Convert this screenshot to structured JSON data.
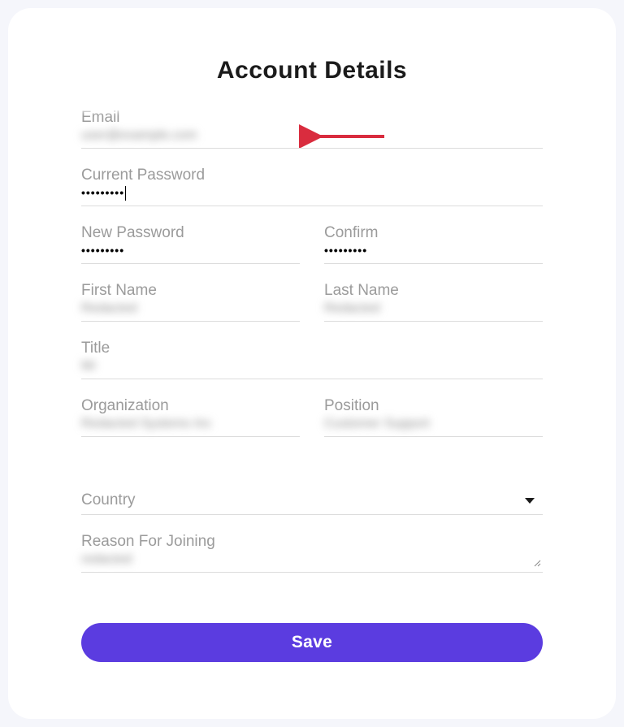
{
  "title": "Account Details",
  "fields": {
    "email": {
      "label": "Email",
      "value": "user@example.com"
    },
    "currentPassword": {
      "label": "Current Password",
      "value": "•••••••••"
    },
    "newPassword": {
      "label": "New Password",
      "value": "•••••••••"
    },
    "confirm": {
      "label": "Confirm",
      "value": "•••••••••"
    },
    "firstName": {
      "label": "First Name",
      "value": "Redacted"
    },
    "lastName": {
      "label": "Last Name",
      "value": "Redacted"
    },
    "title": {
      "label": "Title",
      "value": "Mr"
    },
    "organization": {
      "label": "Organization",
      "value": "Redacted Systems Inc"
    },
    "position": {
      "label": "Position",
      "value": "Customer Support"
    },
    "country": {
      "label": "Country",
      "value": ""
    },
    "reason": {
      "label": "Reason For Joining",
      "value": "redacted"
    }
  },
  "saveLabel": "Save"
}
